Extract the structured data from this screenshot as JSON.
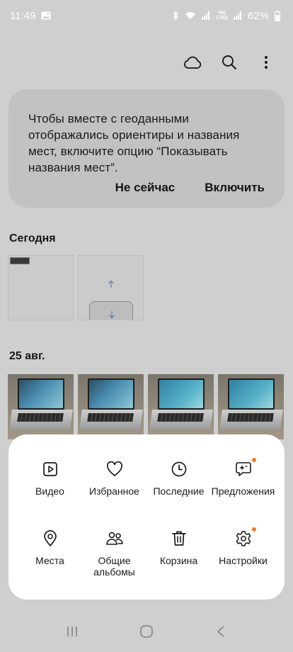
{
  "status_bar": {
    "time": "11:49",
    "battery": "62%",
    "icons": [
      "image-icon",
      "bluetooth-icon",
      "wifi-icon",
      "signal-icon",
      "volte-lte-icon",
      "signal-icon"
    ],
    "volte_label": "Vo)\nLTE2",
    "text_color": "#ffffff"
  },
  "toolbar": {
    "icons": [
      "cloud-icon",
      "search-icon",
      "more-vertical-icon"
    ]
  },
  "prompt": {
    "text": "Чтобы вместе с геоданными отображались ориентиры и названия мест, включите опцию “Показывать названия мест”.",
    "dismiss_label": "Не сейчас",
    "enable_label": "Включить"
  },
  "sections": [
    {
      "title": "Сегодня"
    },
    {
      "title": "25 авг."
    }
  ],
  "menu": {
    "items": [
      {
        "label": "Видео",
        "icon": "video-icon",
        "badge": false
      },
      {
        "label": "Избранное",
        "icon": "heart-icon",
        "badge": false
      },
      {
        "label": "Последние",
        "icon": "clock-icon",
        "badge": false
      },
      {
        "label": "Предложения",
        "icon": "suggestions-icon",
        "badge": true
      },
      {
        "label": "Места",
        "icon": "location-pin-icon",
        "badge": false
      },
      {
        "label": "Общие альбомы",
        "icon": "shared-albums-icon",
        "badge": false
      },
      {
        "label": "Корзина",
        "icon": "trash-icon",
        "badge": false
      },
      {
        "label": "Настройки",
        "icon": "settings-icon",
        "badge": true
      }
    ],
    "badge_color": "#f27a2c"
  },
  "nav_bar": {
    "icons": [
      "recents-icon",
      "home-icon",
      "back-icon"
    ]
  }
}
